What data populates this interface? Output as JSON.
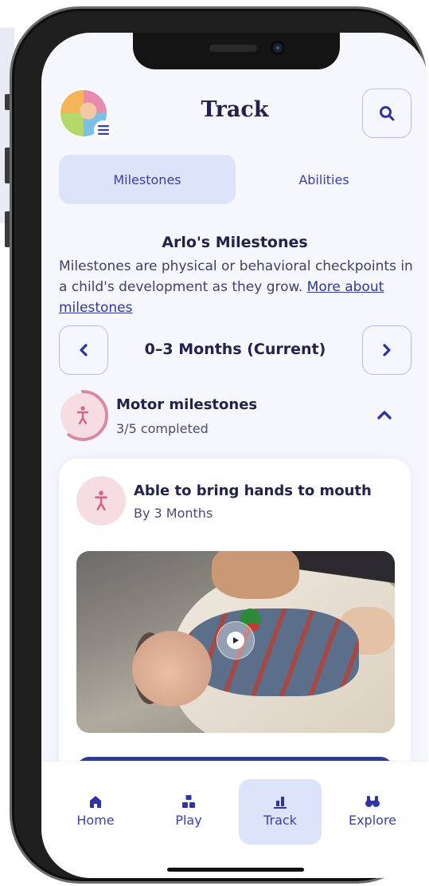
{
  "header": {
    "title": "Track"
  },
  "tabs": [
    {
      "label": "Milestones",
      "active": true
    },
    {
      "label": "Abilities",
      "active": false
    }
  ],
  "intro": {
    "title": "Arlo's Milestones",
    "description": "Milestones are physical or behavioral checkpoints in a child's development as they grow.",
    "link": "More about milestones"
  },
  "period": {
    "label": "0–3 Months (Current)"
  },
  "category": {
    "title": "Motor milestones",
    "progress_text": "3/5 completed",
    "completed": 3,
    "total": 5
  },
  "milestone": {
    "title": "Able to bring hands to mouth",
    "subtitle": "By 3 Months"
  },
  "nav": [
    {
      "label": "Home"
    },
    {
      "label": "Play"
    },
    {
      "label": "Track"
    },
    {
      "label": "Explore"
    }
  ],
  "colors": {
    "accent": "#3a3fa8",
    "motor": "#d88aa3",
    "background": "#f6f7fd"
  },
  "icons": {
    "avatar_menu": "menu-icon",
    "search": "search-icon",
    "prev": "chevron-left-icon",
    "next": "chevron-right-icon",
    "collapse": "chevron-up-icon",
    "motor": "child-figure-icon",
    "play": "play-icon"
  }
}
